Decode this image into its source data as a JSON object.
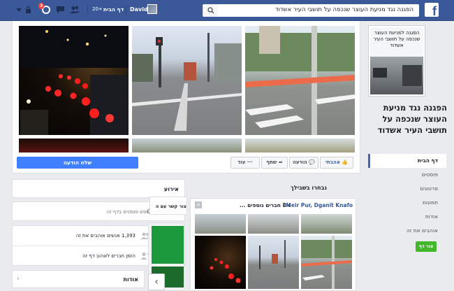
{
  "topbar": {
    "search_value": "הפגנה נגד מניעת העוצר שנכפה על תושבי העיר אשדוד",
    "user_name": "David",
    "home_label": "דף הבית",
    "home_count": "20+",
    "notification_count": "3"
  },
  "post": {
    "send_message_label": "שלח הודעה",
    "like_label": "אהבתי",
    "message_label": "הודעה",
    "share_label": "שתף",
    "more_label": "עוד",
    "more_dots": "···"
  },
  "sidebar": {
    "cover_caption": "הפגנה למניעת העוצר שנכפה על תושבי העיר אשדוד",
    "page_name": "הפגנה נגד מניעת העוצר שנכפה על תושבי העיר אשדוד",
    "nav_items": [
      {
        "label": "דף הבית"
      },
      {
        "label": "פוסטים"
      },
      {
        "label": "סרטונים"
      },
      {
        "label": "תמונות"
      },
      {
        "label": "אודות"
      },
      {
        "label": "אוהבים את זה"
      }
    ],
    "create_page_label": "צור דף"
  },
  "event_box": {
    "title": "אירוע"
  },
  "search_posts": {
    "placeholder": "חפש פוסטים בדף זה"
  },
  "stats": {
    "likes_text": "1,393 אנשים אוהבים את זה",
    "invite_text": "הזמן חברים לאהוב דף זה"
  },
  "about_box": {
    "title": "אודות"
  },
  "chosen": {
    "header": "נבחרו בשבילך",
    "contact_label": "צור קשר עם ה",
    "friends_names": "Meir Pur, Dganit Knafo",
    "friends_suffix": "ו-8 חברים נוספים ..."
  },
  "colors": {
    "brand": "#3b5998",
    "accent": "#4080ff",
    "create_page": "#42b72a"
  }
}
